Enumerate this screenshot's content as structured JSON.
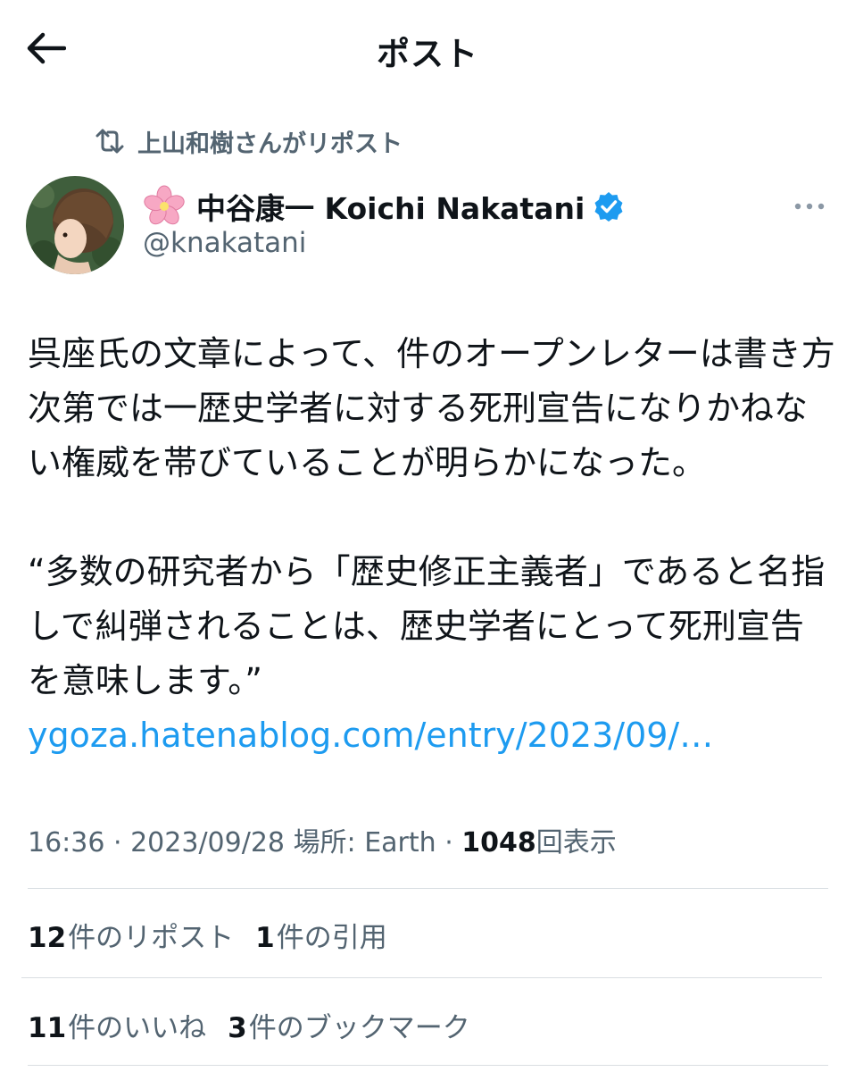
{
  "header": {
    "title": "ポスト",
    "back_icon": "arrow-left-icon"
  },
  "repost": {
    "label": "上山和樹さんがリポスト",
    "icon": "repost-icon"
  },
  "author": {
    "emoji": "🌸",
    "display_name": "中谷康一 Koichi Nakatani",
    "handle": "@knakatani",
    "verified": true,
    "verified_color": "#1d9bf0"
  },
  "tweet": {
    "paragraph1": "呉座氏の文章によって、件のオープンレターは書き方次第では一歴史学者に対する死刑宣告になりかねない権威を帯びていることが明らかになった。",
    "paragraph2": "“多数の研究者から「歴史修正主義者」であると名指しで糾弾されることは、歴史学者にとって死刑宣告を意味します。” ",
    "link_text": "ygoza.hatenablog.com/entry/2023/09/…"
  },
  "meta": {
    "time": "16:36",
    "date": "2023/09/28",
    "location": "場所: Earth",
    "views_count": "1048",
    "views_label": "回表示"
  },
  "stats": {
    "reposts_count": "12",
    "reposts_label": "件のリポスト",
    "quotes_count": "1",
    "quotes_label": "件の引用",
    "likes_count": "11",
    "likes_label": "件のいいね",
    "bookmarks_count": "3",
    "bookmarks_label": "件のブックマーク"
  },
  "colors": {
    "accent": "#1d9bf0",
    "muted": "#536471",
    "text": "#0f1419",
    "divider": "#d9dee2"
  }
}
